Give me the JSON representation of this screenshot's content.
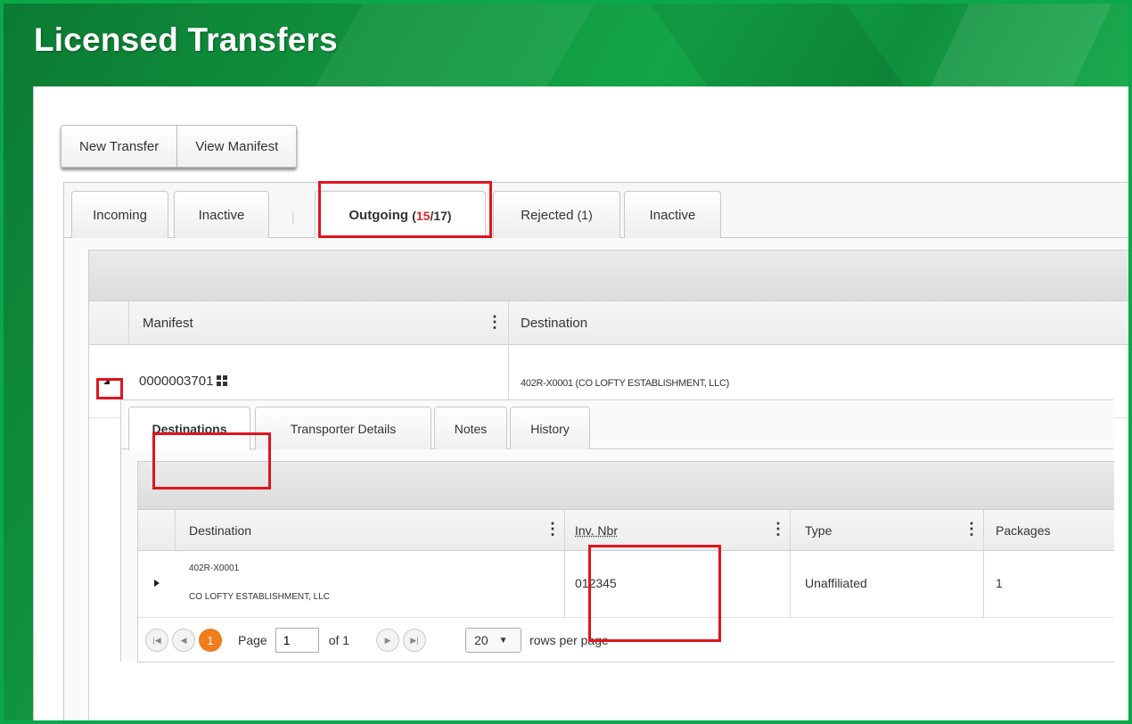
{
  "header": {
    "title": "Licensed Transfers"
  },
  "toolbar": {
    "new_transfer": "New Transfer",
    "view_manifest": "View Manifest"
  },
  "tabs": {
    "incoming": "Incoming",
    "inactive_in": "Inactive",
    "separator": "|",
    "outgoing_label": "Outgoing",
    "outgoing_open": "(",
    "outgoing_active": "15",
    "outgoing_total": "/17)",
    "rejected_label": "Rejected",
    "rejected_count": "(1)",
    "inactive_out": "Inactive"
  },
  "grid": {
    "columns": [
      "Manifest",
      "Destination"
    ],
    "rows": [
      {
        "manifest": "0000003701",
        "destination": "402R-X0001 (CO LOFTY ESTABLISHMENT, LLC)"
      }
    ]
  },
  "detail": {
    "tabs": [
      "Destinations",
      "Transporter Details",
      "Notes",
      "History"
    ],
    "columns": [
      "Destination",
      "Inv. Nbr",
      "Type",
      "Packages"
    ],
    "rows": [
      {
        "dest_license": "402R-X0001",
        "dest_name": "CO LOFTY ESTABLISHMENT, LLC",
        "inv_nbr": "012345",
        "type": "Unaffiliated",
        "packages": "1"
      }
    ],
    "pager": {
      "current": "1",
      "page_label": "Page",
      "page_value": "1",
      "of_label": "of 1",
      "rows_value": "20",
      "rows_label": "rows per page"
    }
  },
  "colors": {
    "highlight": "#e0141e",
    "brand_green": "#14a547",
    "pager_orange": "#f07c1b",
    "red_count": "#e3242b"
  }
}
